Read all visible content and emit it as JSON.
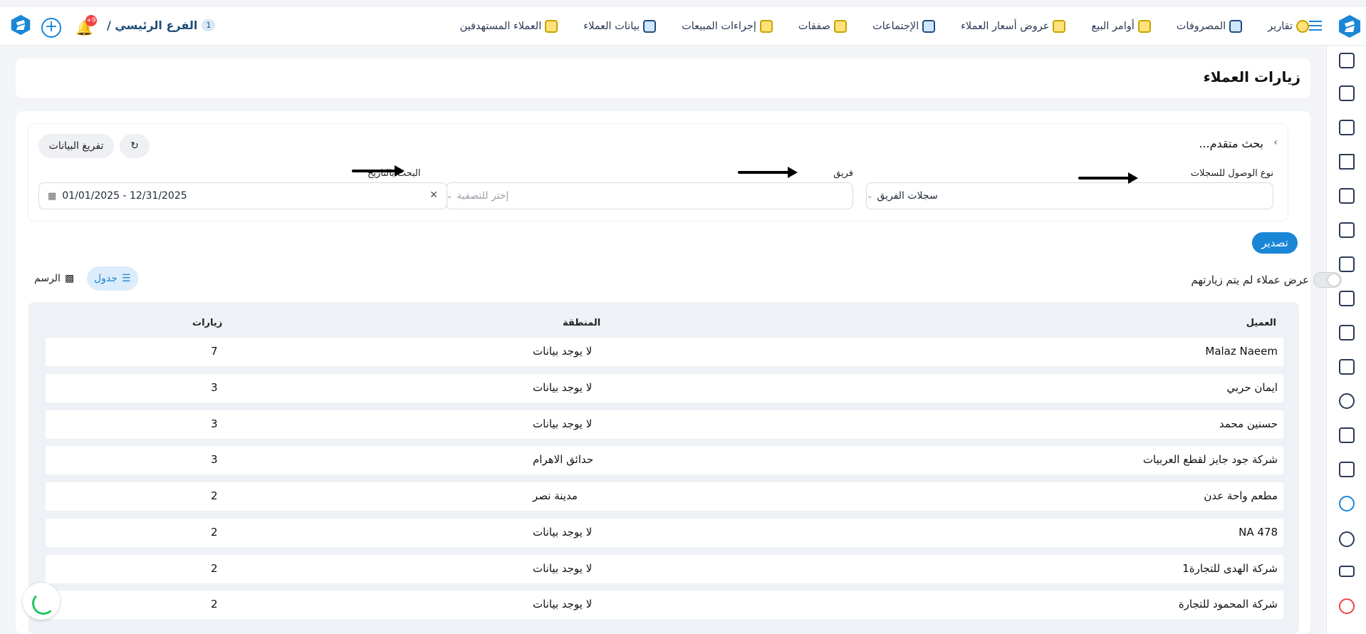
{
  "topbar": {
    "nav": [
      {
        "label": "العملاء المستهدفين",
        "icon": "people-target-icon"
      },
      {
        "label": "بيانات العملاء",
        "icon": "client-data-icon"
      },
      {
        "label": "إجراءات المبيعات",
        "icon": "sales-actions-icon"
      },
      {
        "label": "صفقات",
        "icon": "deals-icon"
      },
      {
        "label": "الإجتماعات",
        "icon": "meetings-icon"
      },
      {
        "label": "عروض أسعار العملاء",
        "icon": "quotes-icon"
      },
      {
        "label": "أوامر البيع",
        "icon": "sales-orders-icon"
      },
      {
        "label": "المصروفات",
        "icon": "expenses-icon"
      },
      {
        "label": "تقارير",
        "icon": "reports-icon"
      }
    ],
    "branch_label": "الفرع الرئيسي /",
    "branch_count": "1",
    "notification_count": "+9"
  },
  "page": {
    "title": "زيارات العملاء"
  },
  "filters": {
    "advanced_search": "بحث متقدم...",
    "clear_button": "تفريغ البيانات",
    "access_type_label": "نوع الوصول للسجلات",
    "access_type_value": "سجلات الفريق",
    "team_label": "فريق",
    "team_placeholder": "إختر للتصفية",
    "date_label": "البحث بالتاريخ",
    "date_range": "01/01/2025 - 12/31/2025"
  },
  "actions": {
    "export_label": "تصدير",
    "toggle_label": "عرض عملاء لم يتم زيارتهم",
    "table_tab": "جدول",
    "chart_tab": "الرسم"
  },
  "table": {
    "headers": {
      "client": "العميل",
      "region": "المنطقة",
      "visits": "زيارات"
    },
    "rows": [
      {
        "client": "Malaz Naeem",
        "region": "لا يوجد بيانات",
        "visits": "7"
      },
      {
        "client": "ايمان حربي",
        "region": "لا يوجد بيانات",
        "visits": "3"
      },
      {
        "client": "حسنين محمد",
        "region": "لا يوجد بيانات",
        "visits": "3"
      },
      {
        "client": "شركة جود جايز لقطع العربيات",
        "region": "حدائق الاهرام",
        "visits": "3"
      },
      {
        "client": "مطعم واحة عدن",
        "region": "مدينة نصر",
        "visits": "2"
      },
      {
        "client": "NA 478",
        "region": "لا يوجد بيانات",
        "visits": "2"
      },
      {
        "client": "شركة الهدى للتجارة1",
        "region": "لا يوجد بيانات",
        "visits": "2"
      },
      {
        "client": "شركة المحمود للتجارة",
        "region": "لا يوجد بيانات",
        "visits": "2"
      }
    ]
  },
  "colors": {
    "accent": "#1a86d6",
    "brand_navy": "#1f4d7a",
    "danger": "#ef4444",
    "spinner": "#22c55e"
  }
}
